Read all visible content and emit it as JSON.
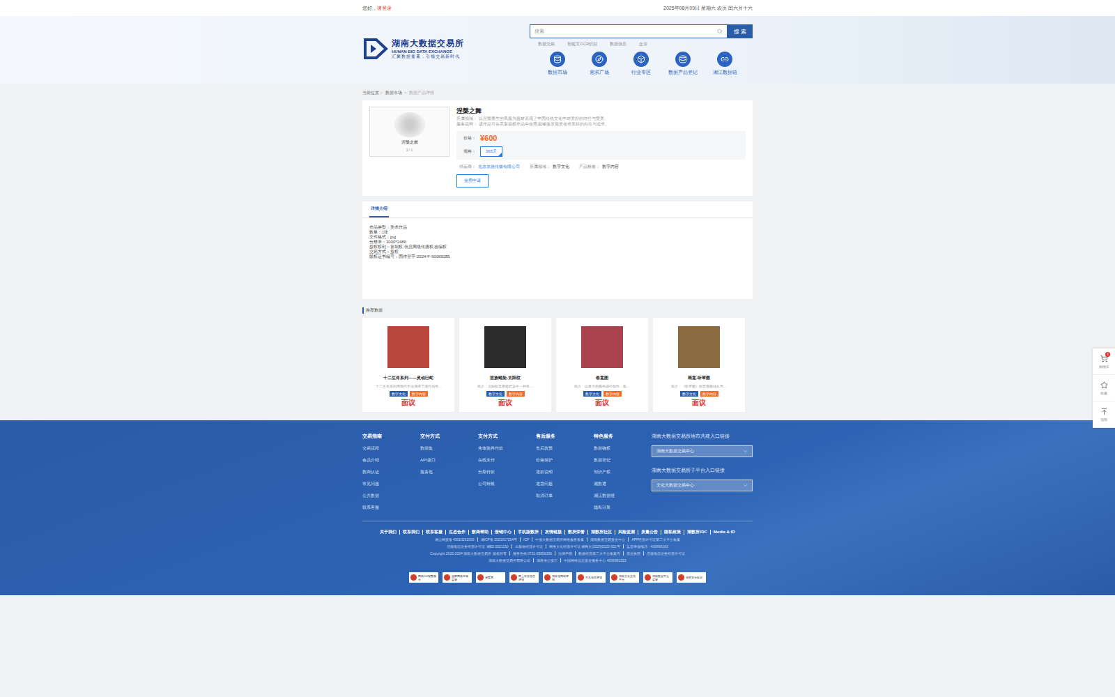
{
  "top_bar": {
    "greeting": "您好，",
    "login": "请登录",
    "date": "2025年08月09日 星期六 农历 闰六月十六"
  },
  "logo": {
    "title": "湖南大数据交易所",
    "subtitle": "HUNAN BIG DATA EXCHANGE",
    "slogan": "汇聚数据要素，引领交易新时代"
  },
  "search": {
    "placeholder": "搜索",
    "button": "搜 索",
    "hot_words": [
      "数据交易",
      "智能文OCR识别",
      "数据信息",
      "企业"
    ]
  },
  "nav": [
    {
      "label": "数据市场",
      "icon": "database"
    },
    {
      "label": "需求广场",
      "icon": "compass"
    },
    {
      "label": "行业专区",
      "icon": "box"
    },
    {
      "label": "数据产品登记",
      "icon": "register"
    },
    {
      "label": "湘江数据链",
      "icon": "link"
    }
  ],
  "breadcrumb": {
    "prefix": "当前位置：",
    "items": [
      "数据市场",
      "数据产品详情"
    ],
    "separator": ">"
  },
  "product": {
    "title": "涅槃之舞",
    "image_caption": "涅槃之舞",
    "image_pager": "1 / 1",
    "lines": [
      {
        "label": "所属领域：",
        "text": "以涅槃重生的凤凰为题材表现了中国传统文化中对美好的向往与赞美。"
      },
      {
        "label": "服务说明：",
        "text": "该作品可在买家授权作品中使用,能够激发观赏者对美好的向往与追求。"
      }
    ],
    "price_label": "价格：",
    "price": "¥600",
    "spec_label": "规格：",
    "specs": [
      {
        "label": "365天",
        "selected": true
      }
    ],
    "meta": [
      {
        "label": "供应商：",
        "value": "北京京路传媒有限公司",
        "kind": "link"
      },
      {
        "label": "所属领域：",
        "value": "数字文化",
        "kind": "plain"
      },
      {
        "label": "产品标签：",
        "value": "数字内容",
        "kind": "plain"
      }
    ],
    "apply_button": "使用申请"
  },
  "detail": {
    "tabs": [
      {
        "label": "详情介绍",
        "selected": true
      }
    ],
    "lines": [
      "作品类型：美术作品",
      "数量：1张",
      "文件格式：jpg",
      "分辨率：3000*2480",
      "授权权利：复制权,信息网络传播权,改编权",
      "交易方式：授权",
      "版权证书编号：国作登字-2024-F-00069285"
    ]
  },
  "recommend": {
    "title": "推荐数据",
    "cards": [
      {
        "title": "十二生肖系列——灵动巳蛇",
        "desc": "十二生肖系列用现代手法演绎了现代与传...",
        "tags": [
          {
            "label": "数字文化",
            "color": "#2a5ba8"
          },
          {
            "label": "数字内容",
            "color": "#f26b2a"
          }
        ],
        "price": "面议",
        "color": "#b8463c"
      },
      {
        "title": "苗族蜡染-太阳纹",
        "desc": "简介：太阳纹是苗族蜡染中一种常...",
        "tags": [
          {
            "label": "数字文化",
            "color": "#2a5ba8"
          },
          {
            "label": "数字内容",
            "color": "#f26b2a"
          }
        ],
        "price": "面议",
        "color": "#2b2b2b"
      },
      {
        "title": "春意图",
        "desc": "简介：以春天的颜色进行创作，取...",
        "tags": [
          {
            "label": "数字文化",
            "color": "#2a5ba8"
          },
          {
            "label": "数字内容",
            "color": "#f26b2a"
          }
        ],
        "price": "面议",
        "color": "#a8434e"
      },
      {
        "title": "画意-听琴图",
        "desc": "简介：《听琴图》创意视频动分为...",
        "tags": [
          {
            "label": "数字文化",
            "color": "#2a5ba8"
          },
          {
            "label": "数字内容",
            "color": "#f26b2a"
          }
        ],
        "price": "面议",
        "color": "#8a6a3e"
      }
    ]
  },
  "float_bar": [
    {
      "label": "购物车",
      "icon": "cart",
      "badge": "0"
    },
    {
      "label": "收藏",
      "icon": "star",
      "badge": ""
    },
    {
      "label": "顶部",
      "icon": "top",
      "badge": ""
    }
  ],
  "footer": {
    "columns": [
      {
        "title": "交易指南",
        "items": [
          "交易流程",
          "会员介绍",
          "数商认证",
          "常见问题",
          "公共数据",
          "联系客服"
        ]
      },
      {
        "title": "交付方式",
        "items": [
          "数据集",
          "API接口",
          "服务包"
        ]
      },
      {
        "title": "支付方式",
        "items": [
          "先体验再付款",
          "在线支付",
          "分期付款",
          "公司转账"
        ]
      },
      {
        "title": "售后服务",
        "items": [
          "售后政策",
          "价格保护",
          "退款说明",
          "退货问题",
          "取消订单"
        ]
      },
      {
        "title": "特色服务",
        "items": [
          "数据确权",
          "数据登记",
          "知识产权",
          "湘数通",
          "湘江数据链",
          "隐私计算"
        ]
      }
    ],
    "entries": [
      {
        "title": "湖南大数据交易所地市共建入口链接",
        "value": "湖南大数据交易中心"
      },
      {
        "title": "湖南大数据交易所子平台入口链接",
        "value": "文化大数据交易中心"
      }
    ],
    "links": [
      "关于我们",
      "联系我们",
      "联系客服",
      "生态合作",
      "数商帮助",
      "营销中心",
      "手机版数所",
      "友情链接",
      "数所荣誉",
      "湖数所社区",
      "风险监测",
      "质量公告",
      "隐私政策",
      "湖数所IDC",
      "Media & IR"
    ],
    "info_lines": [
      [
        "湘公网安备 43010202000",
        "湘ICP备 2021017204号",
        "ICP",
        "中国大数据交易所网络服务备案",
        "湖南数据交易安全中心",
        "APP经营许可证第二大平台备案"
      ],
      [
        "增值电信业务经营许可证 湘B2-2021150",
        "出版物经营许可证",
        "网络文化经营许可证 湘网文(2023)0122-001号",
        "监督举报电话：400696163"
      ],
      [
        "Copyright 2020-2024 湖南大数据交易所 版权所有",
        "服务热线 0731-85856356",
        "法律声明",
        "数据经营第二大平台备案号",
        "营业执照",
        "增值电信业务经营许可证"
      ],
      [
        "湖南大数据交易所有限公司",
        "湖南省公安厅",
        "中国网络信息安全服务中心 4006961553"
      ]
    ],
    "badges": [
      "网络110报警服务",
      "国家网络市场监管",
      "湘警网",
      "网上有害信息举报",
      "湖南省网络举报",
      "不良信息举报",
      "湖南文化交流平台",
      "湖南数据平台监管",
      "信誉安全标识"
    ]
  }
}
